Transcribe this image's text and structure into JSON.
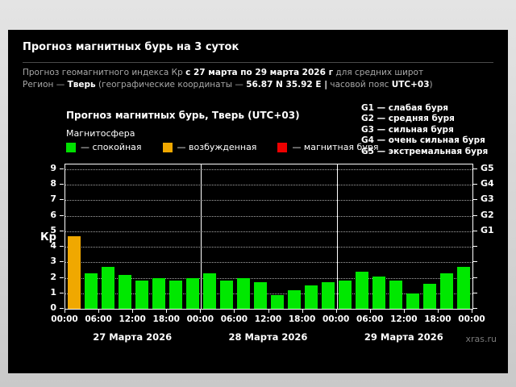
{
  "header": {
    "title": "Прогноз магнитных бурь на 3 суток",
    "subtitle_prefix": "Прогноз геомагнитного индекса Кр ",
    "subtitle_dates": "с 27 марта по 29 марта 2026 г",
    "subtitle_suffix": " для средних широт",
    "region_label": "Регион — ",
    "region_name": "Тверь",
    "region_coords_prefix": " (географические координаты — ",
    "region_coords": "56.87 N 35.92 E |",
    "region_tz_prefix": " часовой пояс ",
    "region_tz": "UTC+03",
    "region_close": ")"
  },
  "chart": {
    "title": "Прогноз магнитных бурь, Тверь (UTC+03)",
    "legend_title": "Магнитосфера",
    "legend": [
      {
        "state": "quiet",
        "label": "— спокойная",
        "color": "#00e000"
      },
      {
        "state": "excited",
        "label": "— возбужденная",
        "color": "#f0a800"
      },
      {
        "state": "storm",
        "label": "— магнитная буря",
        "color": "#ee0000"
      }
    ],
    "g_legend": [
      "G1 — слабая буря",
      "G2 — средняя буря",
      "G3 — сильная буря",
      "G4 — очень сильная буря",
      "G5 — экстремальная буря"
    ],
    "watermark": "xras.ru"
  },
  "chart_data": {
    "type": "bar",
    "title": "Прогноз магнитных бурь, Тверь (UTC+03)",
    "ylabel": "Кр",
    "ylim": [
      0,
      9
    ],
    "y_ticks": [
      0,
      1,
      2,
      3,
      4,
      5,
      6,
      7,
      8,
      9
    ],
    "right_axis_labels": [
      {
        "value": 5,
        "label": "G1"
      },
      {
        "value": 6,
        "label": "G2"
      },
      {
        "value": 7,
        "label": "G3"
      },
      {
        "value": 8,
        "label": "G4"
      },
      {
        "value": 9,
        "label": "G5"
      }
    ],
    "bar_interval_hours": 3,
    "x_tick_labels": [
      "00:00",
      "06:00",
      "12:00",
      "18:00",
      "00:00",
      "06:00",
      "12:00",
      "18:00",
      "00:00",
      "06:00",
      "12:00",
      "18:00",
      "00:00"
    ],
    "state_colors": {
      "quiet": "#00e800",
      "excited": "#f0a800",
      "storm": "#ee0000"
    },
    "days": [
      {
        "label": "27 Марта 2026",
        "values": [
          4.7,
          2.3,
          2.7,
          2.2,
          1.8,
          2.0,
          1.8,
          2.0
        ],
        "states": [
          "excited",
          "quiet",
          "quiet",
          "quiet",
          "quiet",
          "quiet",
          "quiet",
          "quiet"
        ]
      },
      {
        "label": "28 Марта 2026",
        "values": [
          2.3,
          1.8,
          2.0,
          1.7,
          0.9,
          1.2,
          1.5,
          1.7
        ],
        "states": [
          "quiet",
          "quiet",
          "quiet",
          "quiet",
          "quiet",
          "quiet",
          "quiet",
          "quiet"
        ]
      },
      {
        "label": "29 Марта 2026",
        "values": [
          1.8,
          2.4,
          2.1,
          1.8,
          1.0,
          1.6,
          2.3,
          2.7
        ],
        "states": [
          "quiet",
          "quiet",
          "quiet",
          "quiet",
          "quiet",
          "quiet",
          "quiet",
          "quiet"
        ]
      }
    ],
    "grid": "horizontal-dotted",
    "legend_position": "top-left"
  }
}
